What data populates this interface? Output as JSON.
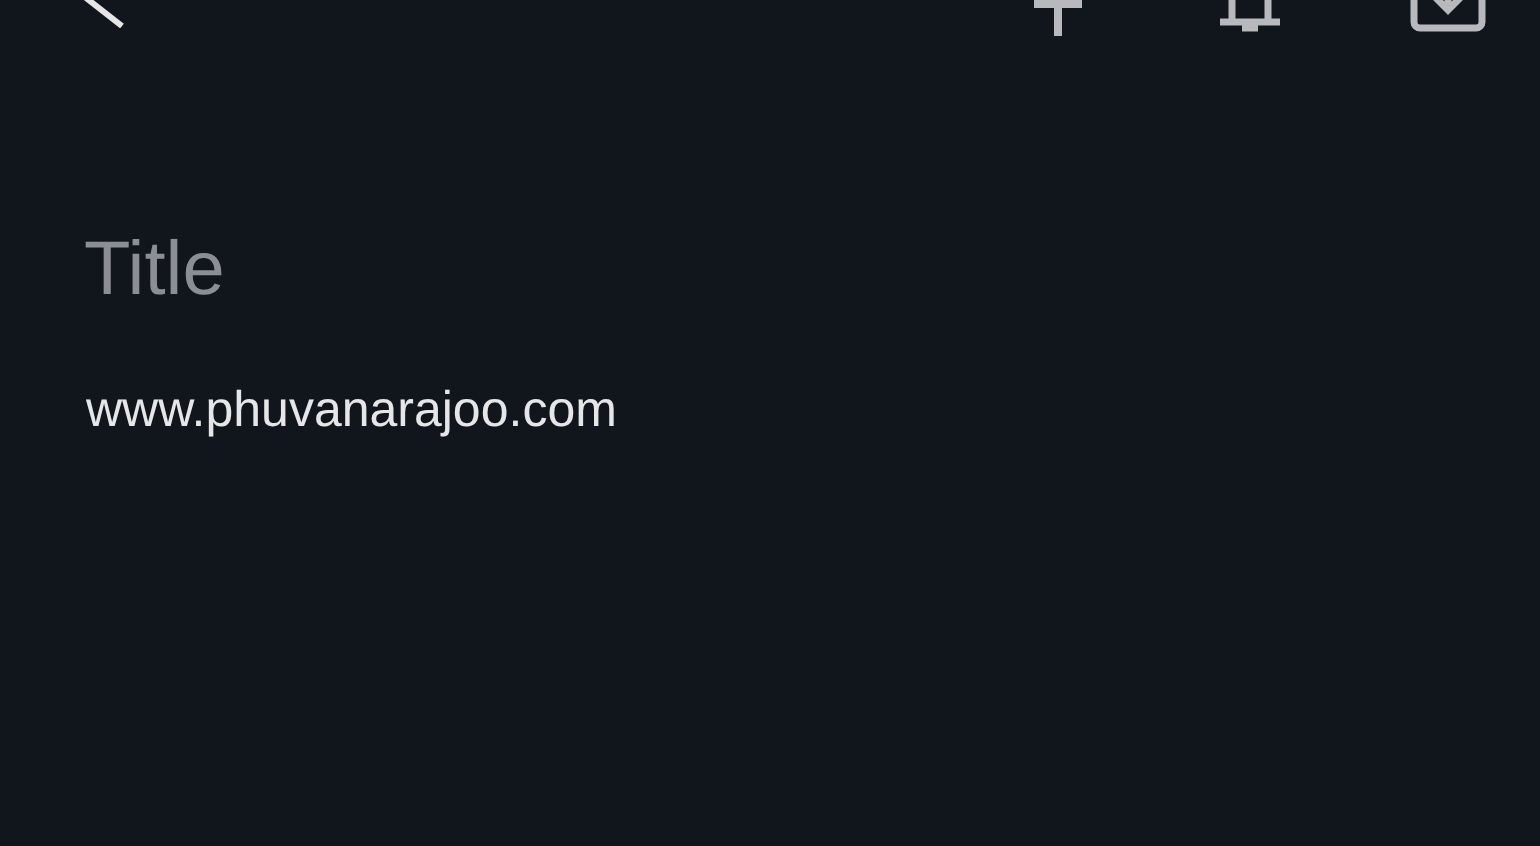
{
  "title": {
    "placeholder": "Title"
  },
  "body": {
    "value": "www.phuvanarajoo.com"
  }
}
